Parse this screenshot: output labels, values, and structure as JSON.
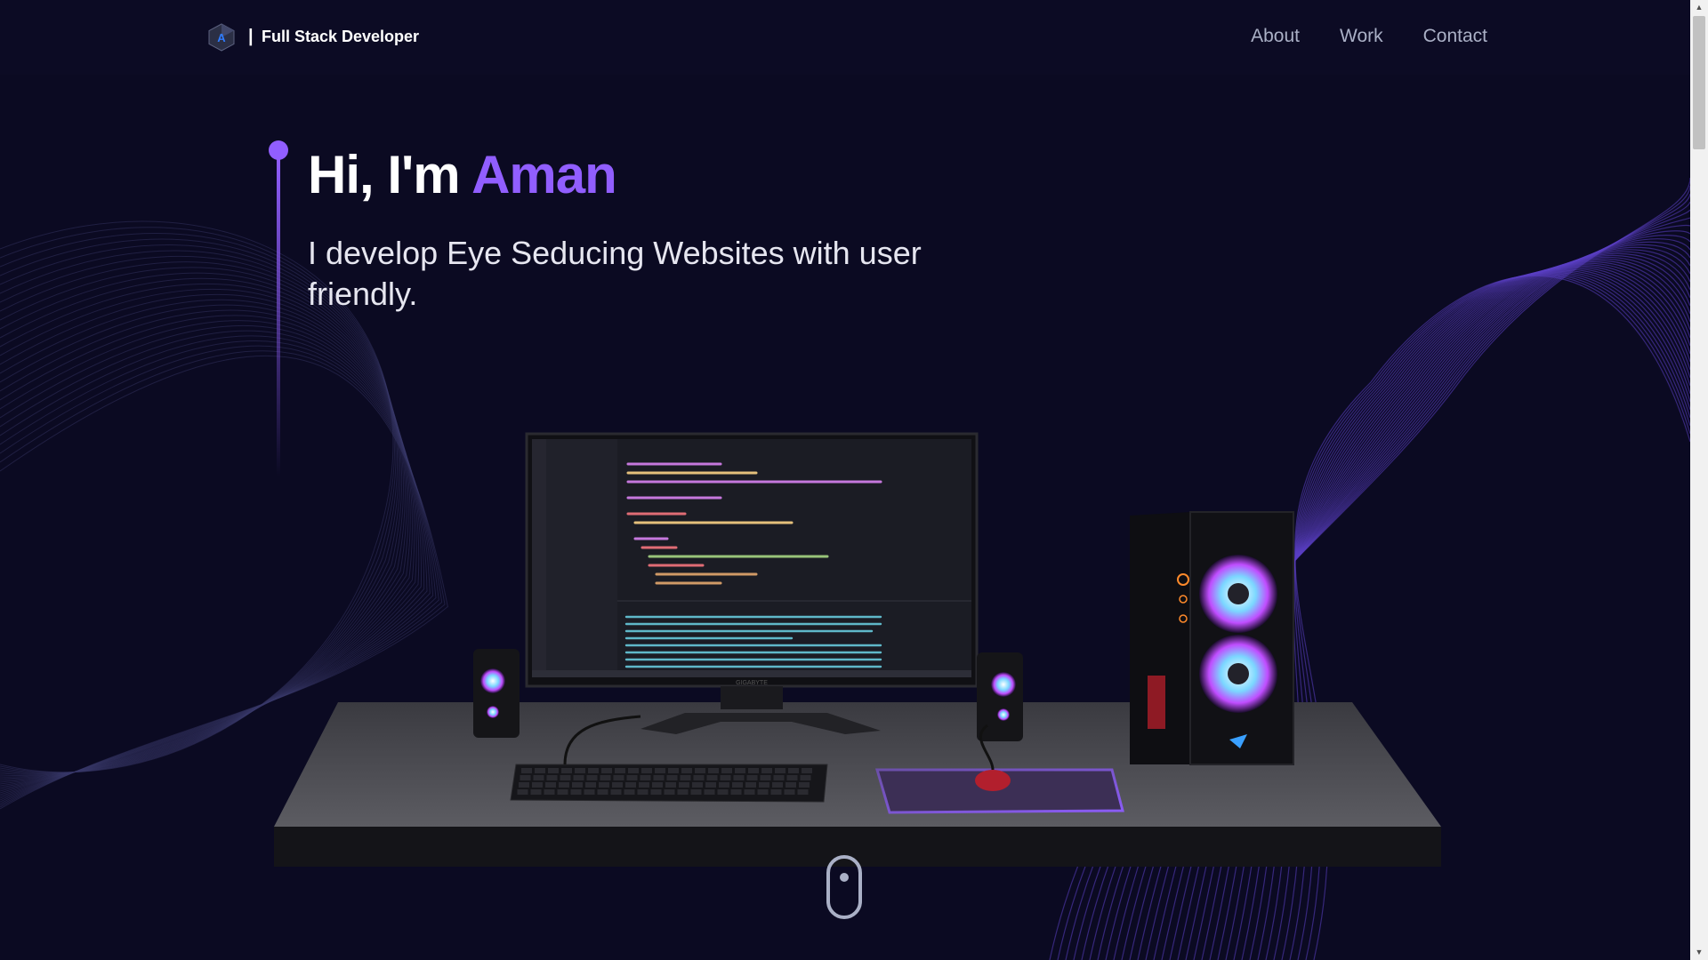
{
  "brand": {
    "separator": "|",
    "title": "Full Stack Developer",
    "logo_letter": "A"
  },
  "nav": {
    "items": [
      {
        "label": "About"
      },
      {
        "label": "Work"
      },
      {
        "label": "Contact"
      }
    ]
  },
  "hero": {
    "greeting": "Hi, I'm ",
    "name": "Aman",
    "subtitle": "I develop Eye Seducing Websites with user friendly."
  },
  "scene": {
    "monitor_brand": "GIGABYTE"
  },
  "colors": {
    "accent": "#915eff",
    "background": "#0b0a22",
    "nav_text": "#aab0c6"
  },
  "icons": {
    "logo": "logo-hexagon-icon",
    "scroll": "mouse-scroll-icon"
  }
}
